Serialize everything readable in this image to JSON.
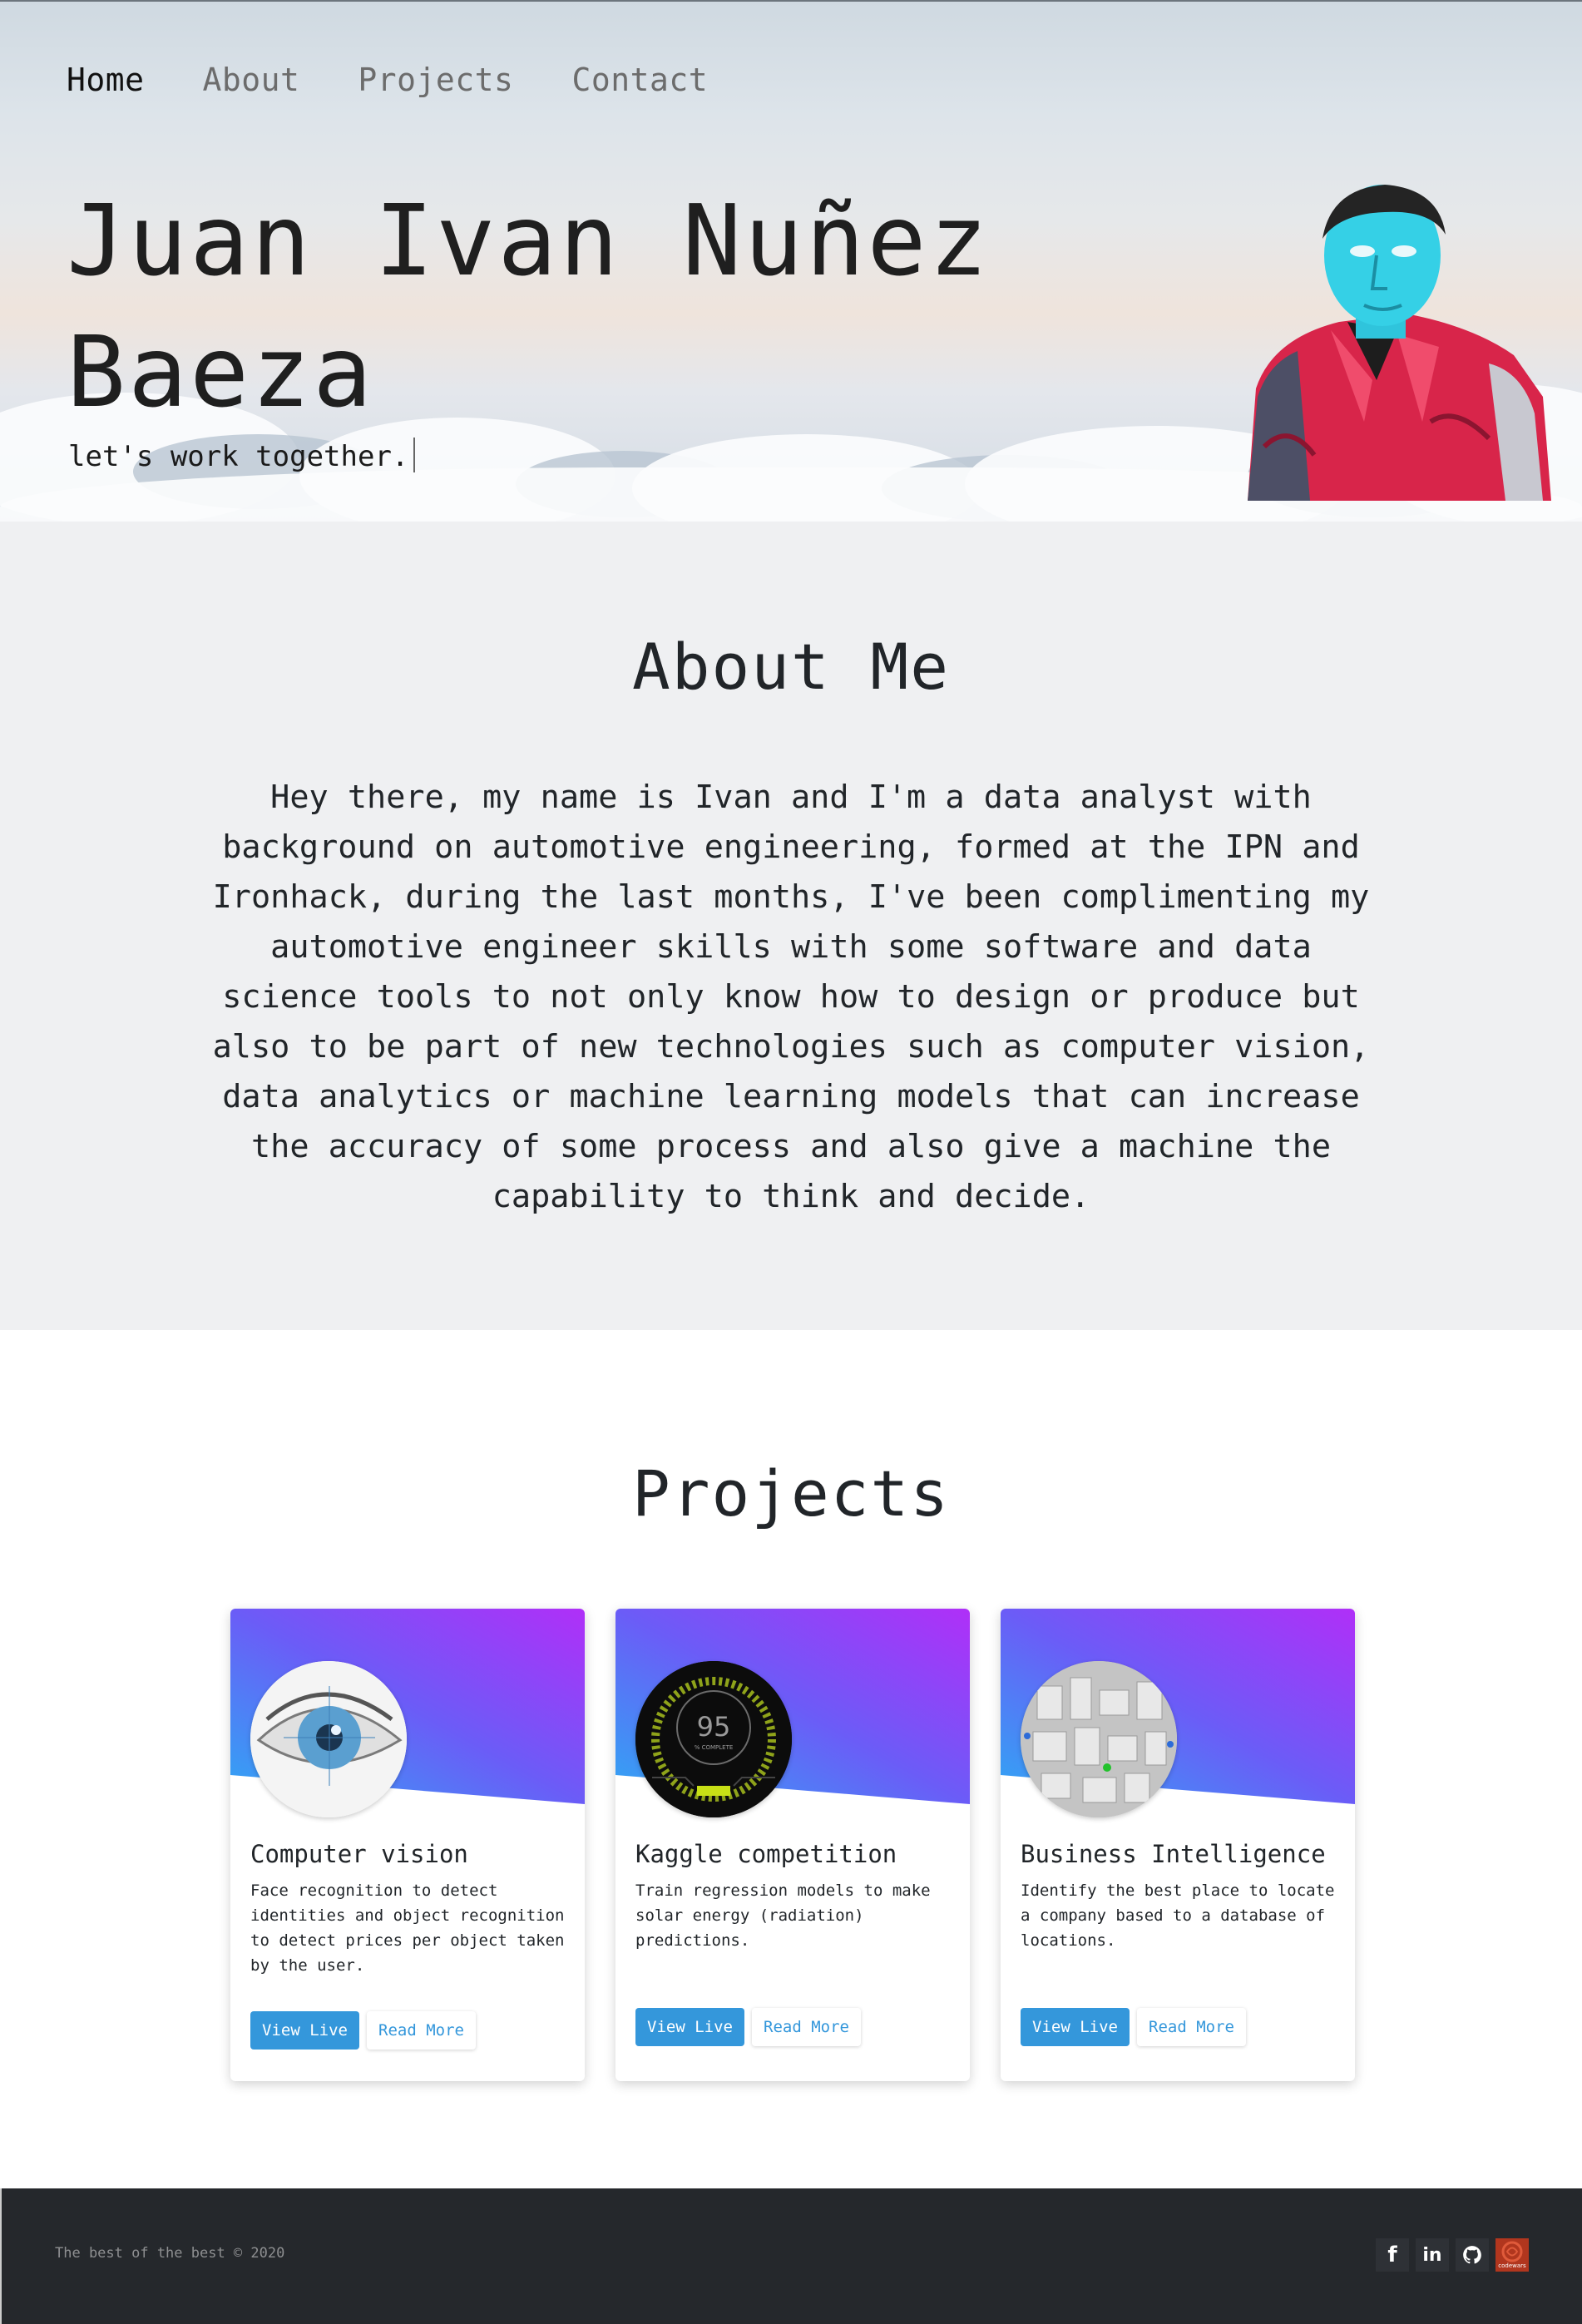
{
  "nav": {
    "items": [
      {
        "label": "Home",
        "active": true
      },
      {
        "label": "About",
        "active": false
      },
      {
        "label": "Projects",
        "active": false
      },
      {
        "label": "Contact",
        "active": false
      }
    ]
  },
  "hero": {
    "name_line1": "Juan Ivan Nuñez",
    "name_line2": "Baeza",
    "subtitle": "let's work together."
  },
  "about": {
    "heading": "About Me",
    "text": "Hey there, my name is Ivan and I'm a data analyst with background on automotive engineering, formed at the IPN and Ironhack, during the last months, I've been complimenting my automotive engineer skills with some software and data science tools to not only know how to design or produce but also to be part of new technologies such as computer vision, data analytics or machine learning models that can increase the accuracy of some process and also give a machine the capability to think and decide."
  },
  "projects": {
    "heading": "Projects",
    "cards": [
      {
        "title": "Computer vision",
        "description": "Face recognition to detect identities and object recognition to detect prices per object taken by the user.",
        "view_label": "View Live",
        "more_label": "Read More"
      },
      {
        "title": "Kaggle competition",
        "description": "Train regression models to make solar energy (radiation) predictions.",
        "view_label": "View Live",
        "more_label": "Read More",
        "gauge_value": "95",
        "gauge_caption": "% COMPLETE"
      },
      {
        "title": "Business Intelligence",
        "description": "Identify the best place to locate a company based to a database of locations.",
        "view_label": "View Live",
        "more_label": "Read More"
      }
    ],
    "banner_colors": [
      "#2fa8f4",
      "#6b5cf7",
      "#b02ff8"
    ]
  },
  "footer": {
    "copyright": "The best of the best © 2020",
    "social": [
      {
        "icon": "facebook-icon",
        "glyph": "f"
      },
      {
        "icon": "linkedin-icon",
        "glyph": "in"
      },
      {
        "icon": "github-icon",
        "glyph": ""
      },
      {
        "icon": "codewars-icon",
        "glyph": "codewars"
      }
    ]
  }
}
